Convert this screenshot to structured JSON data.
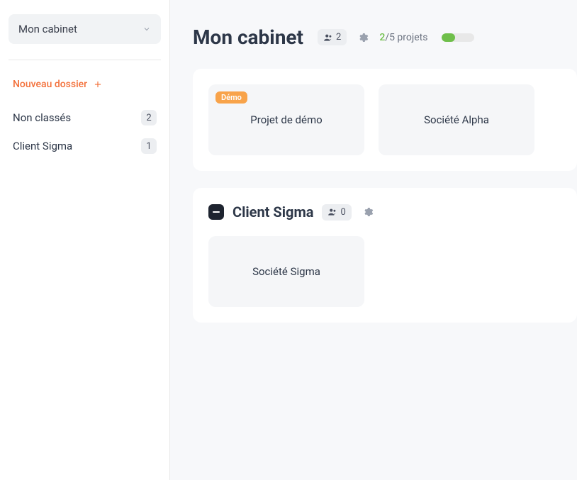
{
  "sidebar": {
    "workspace": "Mon cabinet",
    "new_folder_label": "Nouveau dossier",
    "folders": [
      {
        "label": "Non classés",
        "count": "2"
      },
      {
        "label": "Client Sigma",
        "count": "1"
      }
    ]
  },
  "header": {
    "title": "Mon cabinet",
    "member_count": "2",
    "usage_current": "2",
    "usage_separator": "/",
    "usage_total": "5 projets",
    "usage_fill_percent": 40
  },
  "sections": [
    {
      "folder_icon": false,
      "projects": [
        {
          "name": "Projet de démo",
          "demo_label": "Démo"
        },
        {
          "name": "Société Alpha",
          "demo_label": null
        }
      ]
    },
    {
      "folder_icon": true,
      "title": "Client Sigma",
      "member_count": "0",
      "projects": [
        {
          "name": "Société Sigma",
          "demo_label": null
        }
      ]
    }
  ]
}
